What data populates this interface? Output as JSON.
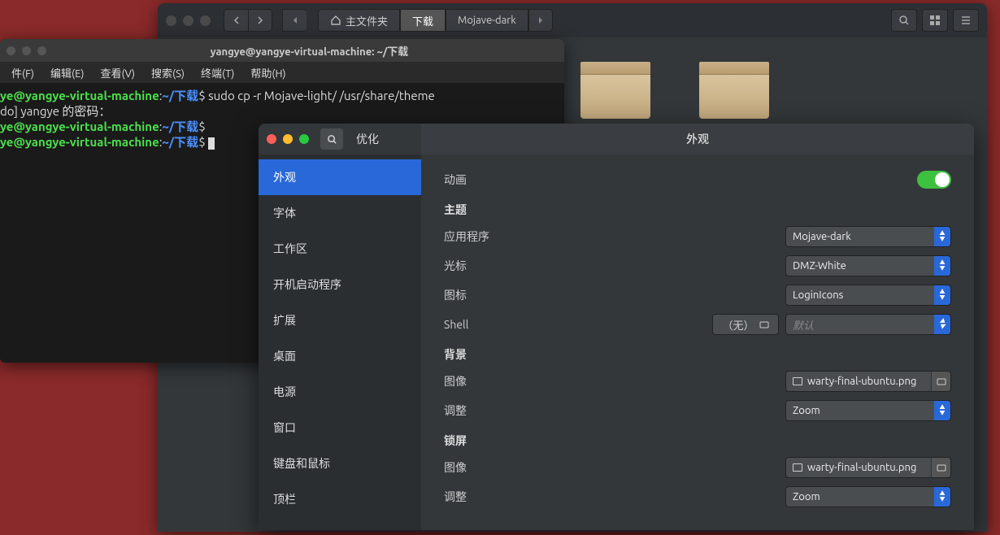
{
  "fileManager": {
    "pathSegments": {
      "home": "主文件夹",
      "downloads": "下载",
      "mojave": "Mojave-dark"
    }
  },
  "terminal": {
    "title": "yangye@yangye-virtual-machine: ~/下载",
    "menu": {
      "file": "件(F)",
      "edit": "编辑(E)",
      "view": "查看(V)",
      "search": "搜索(S)",
      "terminal": "终端(T)",
      "help": "帮助(H)"
    },
    "lines": {
      "userhost": "ye@yangye-virtual-machine",
      "colon": ":",
      "tilde": "~/",
      "dir": "下载",
      "dollar": "$ ",
      "cmd1": "sudo cp -r Mojave-light/ /usr/share/theme",
      "sudo_prompt": "do] yangye 的密码："
    }
  },
  "tweaks": {
    "sidebarTitle": "优化",
    "headerTitle": "外观",
    "sidebar": {
      "appearance": "外观",
      "fonts": "字体",
      "workspace": "工作区",
      "startup": "开机启动程序",
      "extensions": "扩展",
      "desktop": "桌面",
      "power": "电源",
      "windows": "窗口",
      "keyboard": "键盘和鼠标",
      "topbar": "顶栏"
    },
    "labels": {
      "animation": "动画",
      "theme": "主题",
      "application": "应用程序",
      "cursor": "光标",
      "icon": "图标",
      "shell": "Shell",
      "background": "背景",
      "image": "图像",
      "adjust": "调整",
      "lockscreen": "锁屏",
      "shellNone": "（无）",
      "shellDefault": "默认"
    },
    "values": {
      "application": "Mojave-dark",
      "cursor": "DMZ-White",
      "icon": "LoginIcons",
      "bgImage": "warty-final-ubuntu.png",
      "bgAdjust": "Zoom",
      "lockImage": "warty-final-ubuntu.png",
      "lockAdjust": "Zoom"
    }
  }
}
